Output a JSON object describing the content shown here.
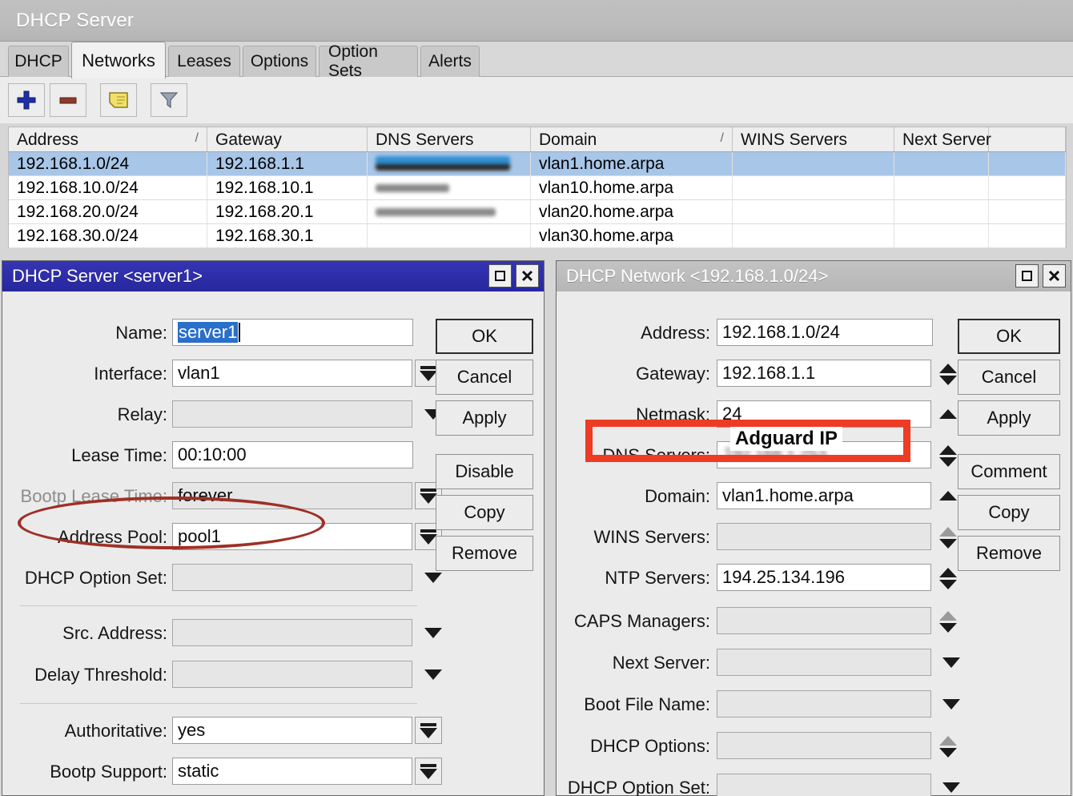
{
  "window": {
    "title": "DHCP Server",
    "tabs": [
      {
        "label": "DHCP",
        "active": false
      },
      {
        "label": "Networks",
        "active": true
      },
      {
        "label": "Leases",
        "active": false
      },
      {
        "label": "Options",
        "active": false
      },
      {
        "label": "Option Sets",
        "active": false
      },
      {
        "label": "Alerts",
        "active": false
      }
    ],
    "toolbar": [
      {
        "name": "add-button",
        "icon": "plus-icon"
      },
      {
        "name": "remove-button",
        "icon": "minus-icon"
      },
      {
        "name": "comment-button",
        "icon": "note-icon"
      },
      {
        "name": "filter-button",
        "icon": "funnel-icon"
      }
    ]
  },
  "table": {
    "columns": [
      {
        "label": "Address",
        "sorted": true
      },
      {
        "label": "Gateway",
        "sorted": false
      },
      {
        "label": "DNS Servers",
        "sorted": false
      },
      {
        "label": "Domain",
        "sorted": true
      },
      {
        "label": "WINS Servers",
        "sorted": false
      },
      {
        "label": "Next Server",
        "sorted": false
      },
      {
        "label": "",
        "sorted": false
      }
    ],
    "sort_glyph": "/",
    "rows": [
      {
        "address": "192.168.1.0/24",
        "gateway": "192.168.1.1",
        "dns": "",
        "domain": "vlan1.home.arpa",
        "wins": "",
        "next": "",
        "selected": true
      },
      {
        "address": "192.168.10.0/24",
        "gateway": "192.168.10.1",
        "dns": "",
        "domain": "vlan10.home.arpa",
        "wins": "",
        "next": "",
        "selected": false
      },
      {
        "address": "192.168.20.0/24",
        "gateway": "192.168.20.1",
        "dns": "",
        "domain": "vlan20.home.arpa",
        "wins": "",
        "next": "",
        "selected": false
      },
      {
        "address": "192.168.30.0/24",
        "gateway": "192.168.30.1",
        "dns": "",
        "domain": "vlan30.home.arpa",
        "wins": "",
        "next": "",
        "selected": false
      }
    ]
  },
  "server_dialog": {
    "title": "DHCP Server <server1>",
    "state": "active",
    "titlebar_buttons": [
      {
        "name": "maximize-button",
        "glyph": "□"
      },
      {
        "name": "close-button",
        "glyph": "✕"
      }
    ],
    "fields": [
      {
        "label": "Name:",
        "value": "server1",
        "control": "text",
        "disabled": false,
        "selected_text": true
      },
      {
        "label": "Interface:",
        "value": "vlan1",
        "control": "dropdown",
        "disabled": false
      },
      {
        "label": "Relay:",
        "value": "",
        "control": "caret",
        "disabled": true
      },
      {
        "label": "Lease Time:",
        "value": "00:10:00",
        "control": "text",
        "disabled": false
      },
      {
        "label": "Bootp Lease Time:",
        "value": "forever",
        "control": "dropdown",
        "disabled": true,
        "label_dim": true
      },
      {
        "label": "Address Pool:",
        "value": "pool1",
        "control": "dropdown",
        "disabled": false
      },
      {
        "label": "DHCP Option Set:",
        "value": "",
        "control": "caret",
        "disabled": true
      },
      {
        "label": "Src. Address:",
        "value": "",
        "control": "caret",
        "disabled": true
      },
      {
        "label": "Delay Threshold:",
        "value": "",
        "control": "caret",
        "disabled": true
      },
      {
        "label": "Authoritative:",
        "value": "yes",
        "control": "dropdown",
        "disabled": false
      },
      {
        "label": "Bootp Support:",
        "value": "static",
        "control": "dropdown",
        "disabled": false
      }
    ],
    "buttons": [
      {
        "label": "OK",
        "default": true
      },
      {
        "label": "Cancel",
        "default": false
      },
      {
        "label": "Apply",
        "default": false
      },
      {
        "label": "Disable",
        "default": false
      },
      {
        "label": "Copy",
        "default": false
      },
      {
        "label": "Remove",
        "default": false
      }
    ]
  },
  "network_dialog": {
    "title": "DHCP Network <192.168.1.0/24>",
    "state": "inactive",
    "titlebar_buttons": [
      {
        "name": "maximize-button",
        "glyph": "□"
      },
      {
        "name": "close-button",
        "glyph": "✕"
      }
    ],
    "fields": [
      {
        "label": "Address:",
        "value": "192.168.1.0/24",
        "control": "none",
        "disabled": false
      },
      {
        "label": "Gateway:",
        "value": "192.168.1.1",
        "control": "spinner",
        "disabled": false
      },
      {
        "label": "Netmask:",
        "value": "24",
        "control": "up",
        "disabled": false
      },
      {
        "label": "DNS Servers:",
        "value": "",
        "control": "spinner",
        "disabled": false,
        "highlighted": true
      },
      {
        "label": "Domain:",
        "value": "vlan1.home.arpa",
        "control": "up",
        "disabled": false
      },
      {
        "label": "WINS Servers:",
        "value": "",
        "control": "spinner-grey-up",
        "disabled": true
      },
      {
        "label": "NTP Servers:",
        "value": "194.25.134.196",
        "control": "spinner",
        "disabled": false
      },
      {
        "label": "CAPS Managers:",
        "value": "",
        "control": "spinner-grey-up",
        "disabled": true
      },
      {
        "label": "Next Server:",
        "value": "",
        "control": "caret",
        "disabled": true
      },
      {
        "label": "Boot File Name:",
        "value": "",
        "control": "caret",
        "disabled": true
      },
      {
        "label": "DHCP Options:",
        "value": "",
        "control": "spinner-grey-up",
        "disabled": true
      },
      {
        "label": "DHCP Option Set:",
        "value": "",
        "control": "caret",
        "disabled": true
      }
    ],
    "buttons": [
      {
        "label": "OK",
        "default": true
      },
      {
        "label": "Cancel",
        "default": false
      },
      {
        "label": "Apply",
        "default": false
      },
      {
        "label": "Comment",
        "default": false
      },
      {
        "label": "Copy",
        "default": false
      },
      {
        "label": "Remove",
        "default": false
      }
    ]
  },
  "annotations": {
    "address_pool_ellipse": {
      "color": "#9e3026"
    },
    "dns_servers_box": {
      "color": "#ee3b24"
    },
    "dns_servers_label": "Adguard IP"
  },
  "colors": {
    "titlebar_active": "#2d2daa",
    "titlebar_inactive": "#bdbdbd",
    "row_selected": "#a8c6e8",
    "annotation_red": "#ee3b24",
    "annotation_dark_red": "#9e3026",
    "plus_icon": "#1d2fa8",
    "minus_icon": "#8c3a2b",
    "note_icon": "#f2e06a",
    "funnel_icon": "#9aa3b4"
  }
}
